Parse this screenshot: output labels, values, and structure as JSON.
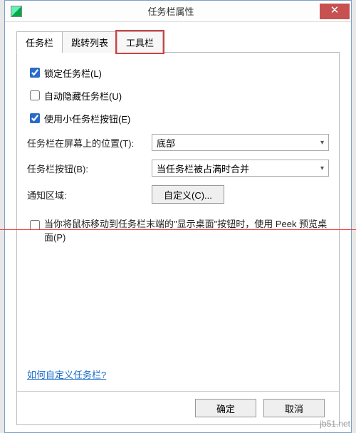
{
  "window": {
    "title": "任务栏属性"
  },
  "tabs": [
    {
      "id": "taskbar",
      "label": "任务栏",
      "active": true
    },
    {
      "id": "jumplist",
      "label": "跳转列表",
      "active": false
    },
    {
      "id": "toolbar",
      "label": "工具栏",
      "active": false,
      "highlighted": true
    }
  ],
  "checkboxes": {
    "lock": {
      "label": "锁定任务栏(L)",
      "checked": true
    },
    "autohide": {
      "label": "自动隐藏任务栏(U)",
      "checked": false
    },
    "small": {
      "label": "使用小任务栏按钮(E)",
      "checked": true
    }
  },
  "rows": {
    "position": {
      "label": "任务栏在屏幕上的位置(T):",
      "value": "底部"
    },
    "buttons": {
      "label": "任务栏按钮(B):",
      "value": "当任务栏被占满时合并"
    },
    "notify": {
      "label": "通知区域:",
      "button": "自定义(C)..."
    }
  },
  "peek": {
    "checked": false,
    "text": "当你将鼠标移动到任务栏末端的\"显示桌面\"按钮时，使用 Peek 预览桌面(P)"
  },
  "link": "如何自定义任务栏?",
  "buttons": {
    "ok": "确定",
    "cancel": "取消"
  },
  "watermark": "jb51.net"
}
